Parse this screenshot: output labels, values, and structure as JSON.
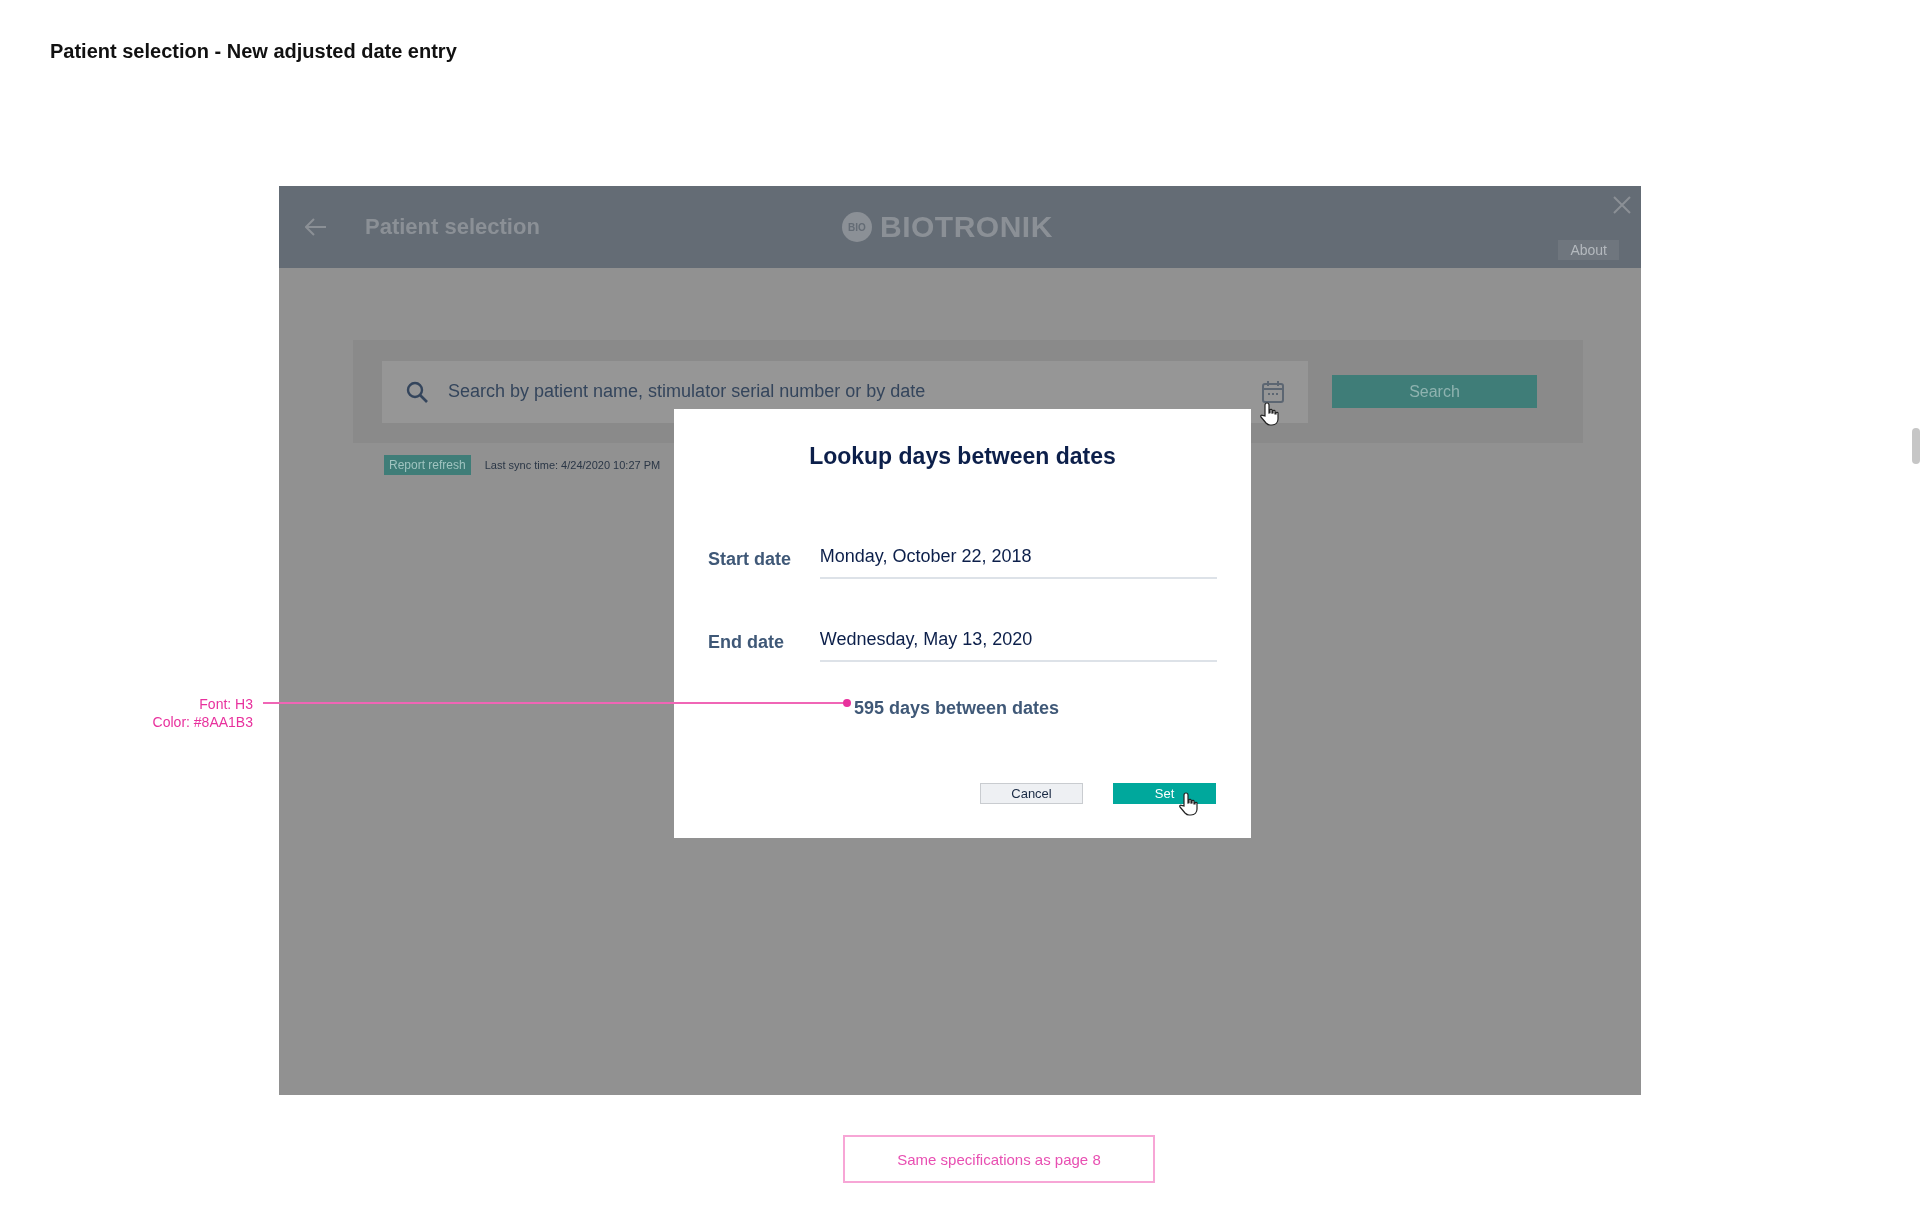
{
  "page_title": "Patient selection - New adjusted date entry",
  "app": {
    "header": {
      "title": "Patient selection",
      "logo_mark": "BIO",
      "logo_text": "BIOTRONIK",
      "about": "About"
    },
    "search": {
      "placeholder": "Search by patient name, stimulator serial number or by date",
      "button": "Search"
    },
    "report_refresh": "Report refresh",
    "last_sync": "Last sync time: 4/24/2020 10:27 PM"
  },
  "dialog": {
    "title": "Lookup days between dates",
    "fields": [
      {
        "label": "Start date",
        "value": "Monday, October 22, 2018"
      },
      {
        "label": "End date",
        "value": "Wednesday, May 13, 2020"
      }
    ],
    "result": "595 days between dates",
    "buttons": [
      {
        "label": "Cancel",
        "kind": "secondary"
      },
      {
        "label": "Set",
        "kind": "primary"
      }
    ]
  },
  "annotation": {
    "lines": [
      "Font: H3",
      "Color: #8AA1B3"
    ]
  },
  "note": "Same specifications as page 8"
}
